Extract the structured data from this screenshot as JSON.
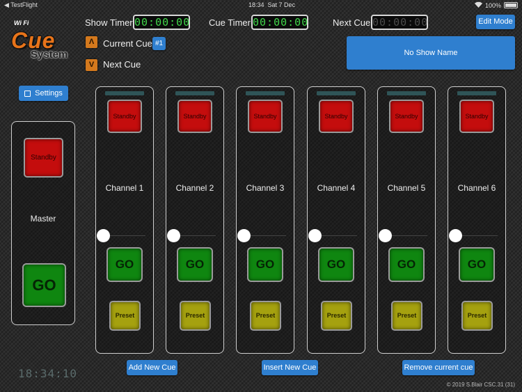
{
  "status_bar": {
    "back_app": "TestFlight",
    "time": "18:34",
    "date": "Sat 7 Dec",
    "battery": "100%"
  },
  "logo": {
    "wifi": "Wi Fi",
    "cue": "Cue",
    "system": "System"
  },
  "header": {
    "show_timer_label": "Show Timer",
    "show_timer_value": "00:00:00",
    "cue_timer_label": "Cue Timer",
    "cue_timer_value": "00:00:00",
    "next_cue_label": "Next Cue",
    "next_cue_value": "00:00:00",
    "edit_mode_label": "Edit Mode",
    "current_cue_label": "Current Cue",
    "current_cue_value": "#1",
    "next_cue_nav_label": "Next Cue",
    "show_name": "No Show Name",
    "up_arrow": "Λ",
    "down_arrow": "V"
  },
  "settings": {
    "label": "Settings"
  },
  "master": {
    "standby_label": "Standby",
    "label": "Master",
    "go_label": "GO"
  },
  "channels": [
    {
      "name": "Channel 1",
      "standby_label": "Standby",
      "go_label": "GO",
      "preset_label": "Preset",
      "level": 0
    },
    {
      "name": "Channel 2",
      "standby_label": "Standby",
      "go_label": "GO",
      "preset_label": "Preset",
      "level": 0
    },
    {
      "name": "Channel 3",
      "standby_label": "Standby",
      "go_label": "GO",
      "preset_label": "Preset",
      "level": 0
    },
    {
      "name": "Channel 4",
      "standby_label": "Standby",
      "go_label": "GO",
      "preset_label": "Preset",
      "level": 0
    },
    {
      "name": "Channel 5",
      "standby_label": "Standby",
      "go_label": "GO",
      "preset_label": "Preset",
      "level": 0
    },
    {
      "name": "Channel 6",
      "standby_label": "Standby",
      "go_label": "GO",
      "preset_label": "Preset",
      "level": 0
    }
  ],
  "footer": {
    "add_label": "Add New Cue",
    "insert_label": "Insert New Cue",
    "remove_label": "Remove current cue",
    "clock": "18:34:10",
    "copyright": "© 2019 S.Blair CSC.31 (31)"
  },
  "colors": {
    "accent": "#2f7fcf",
    "standby": "#c40d0d",
    "go": "#0f8610",
    "preset": "#a5a10f",
    "lcd_text": "#41d64a",
    "logo": "#e8741a"
  }
}
